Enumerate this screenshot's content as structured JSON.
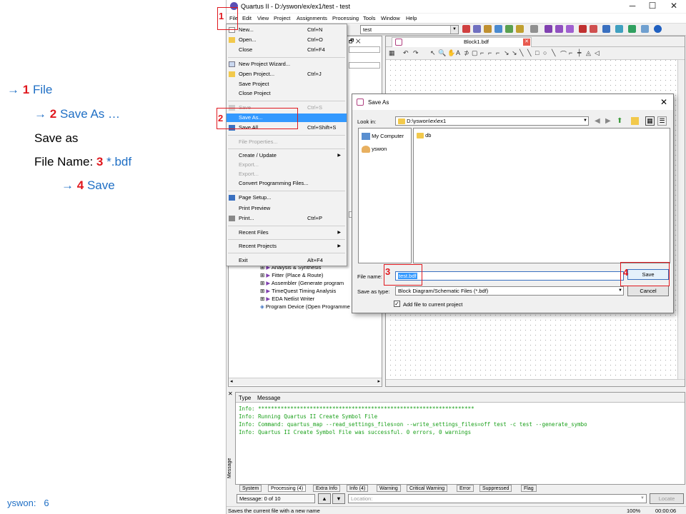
{
  "steps": [
    {
      "arrow": "→",
      "num": "1",
      "label": "File"
    },
    {
      "arrow": "→",
      "num": "2",
      "label": "Save As …"
    },
    {
      "text": "Save as"
    },
    {
      "prefix": "File Name:",
      "num": "3",
      "label": "*.bdf"
    },
    {
      "arrow": "→",
      "num": "4",
      "label": "Save"
    }
  ],
  "footnote": {
    "name": "yswon:",
    "page": "6"
  },
  "app": {
    "title": "Quartus II - D:/yswon/ex/ex1/test - test",
    "menus": [
      "File",
      "Edit",
      "View",
      "Project",
      "Assignments",
      "Processing",
      "Tools",
      "Window",
      "Help"
    ],
    "project_combo": "test",
    "editor_tab": "Block1.bdf"
  },
  "file_menu": [
    {
      "label": "New...",
      "shortcut": "Ctrl+N",
      "disabled": false
    },
    {
      "label": "Open...",
      "shortcut": "Ctrl+O",
      "disabled": false
    },
    {
      "label": "Close",
      "shortcut": "Ctrl+F4",
      "disabled": false
    },
    {
      "label": "New Project Wizard...",
      "shortcut": "",
      "disabled": false
    },
    {
      "label": "Open Project...",
      "shortcut": "Ctrl+J",
      "disabled": false
    },
    {
      "label": "Save Project",
      "shortcut": "",
      "disabled": false
    },
    {
      "label": "Close Project",
      "shortcut": "",
      "disabled": false
    },
    {
      "label": "Save",
      "shortcut": "Ctrl+S",
      "disabled": true
    },
    {
      "label": "Save As...",
      "shortcut": "",
      "disabled": false,
      "highlighted": true
    },
    {
      "label": "Save All",
      "shortcut": "Ctrl+Shift+S",
      "disabled": false
    },
    {
      "label": "File Properties...",
      "shortcut": "",
      "disabled": true
    },
    {
      "label": "Create / Update",
      "shortcut": "",
      "disabled": false,
      "submenu": true
    },
    {
      "label": "Export...",
      "shortcut": "",
      "disabled": true
    },
    {
      "label": "Export...",
      "shortcut": "",
      "disabled": true
    },
    {
      "label": "Convert Programming Files...",
      "shortcut": "",
      "disabled": false
    },
    {
      "label": "Page Setup...",
      "shortcut": "",
      "disabled": false
    },
    {
      "label": "Print Preview",
      "shortcut": "",
      "disabled": false
    },
    {
      "label": "Print...",
      "shortcut": "Ctrl+P",
      "disabled": false
    },
    {
      "label": "Recent Files",
      "shortcut": "",
      "disabled": false,
      "submenu": true
    },
    {
      "label": "Recent Projects",
      "shortcut": "",
      "disabled": false,
      "submenu": true
    },
    {
      "label": "Exit",
      "shortcut": "Alt+F4",
      "disabled": false
    }
  ],
  "tasks": [
    "Analysis & Synthesis",
    "Fitter (Place & Route)",
    "Assembler (Generate program",
    "TimeQuest Timing Analysis",
    "EDA Netlist Writer",
    "Program Device (Open Programme"
  ],
  "dialog": {
    "title": "Save As",
    "look_in_label": "Look in:",
    "look_in_value": "D:\\yswon\\ex\\ex1",
    "places": [
      "My Computer",
      "yswon"
    ],
    "files": [
      "db"
    ],
    "file_name_label": "File name:",
    "file_name_value": "test.bdf",
    "save_type_label": "Save as type:",
    "save_type_value": "Block Diagram/Schematic Files (*.bdf)",
    "add_file_label": "Add file to current project",
    "add_file_checked": true,
    "save_button": "Save",
    "cancel_button": "Cancel"
  },
  "messages": {
    "col_type": "Type",
    "col_message": "Message",
    "lines": [
      "Info: *******************************************************************",
      "Info: Running Quartus II Create Symbol File",
      "Info: Command: quartus_map --read_settings_files=on --write_settings_files=off test -c test --generate_symbo",
      "Info: Quartus II Create Symbol File was successful. 0 errors, 0 warnings"
    ],
    "tabs": [
      "System",
      "Processing (4)",
      "Extra Info",
      "Info (4)",
      "Warning",
      "Critical Warning",
      "Error",
      "Suppressed",
      "Flag"
    ],
    "message_count": "Message: 0 of 10",
    "location_placeholder": "Location:",
    "locate_button": "Locate"
  },
  "status": {
    "text": "Saves the current file with a new name",
    "zoom": "100%",
    "time": "00:00:06"
  }
}
